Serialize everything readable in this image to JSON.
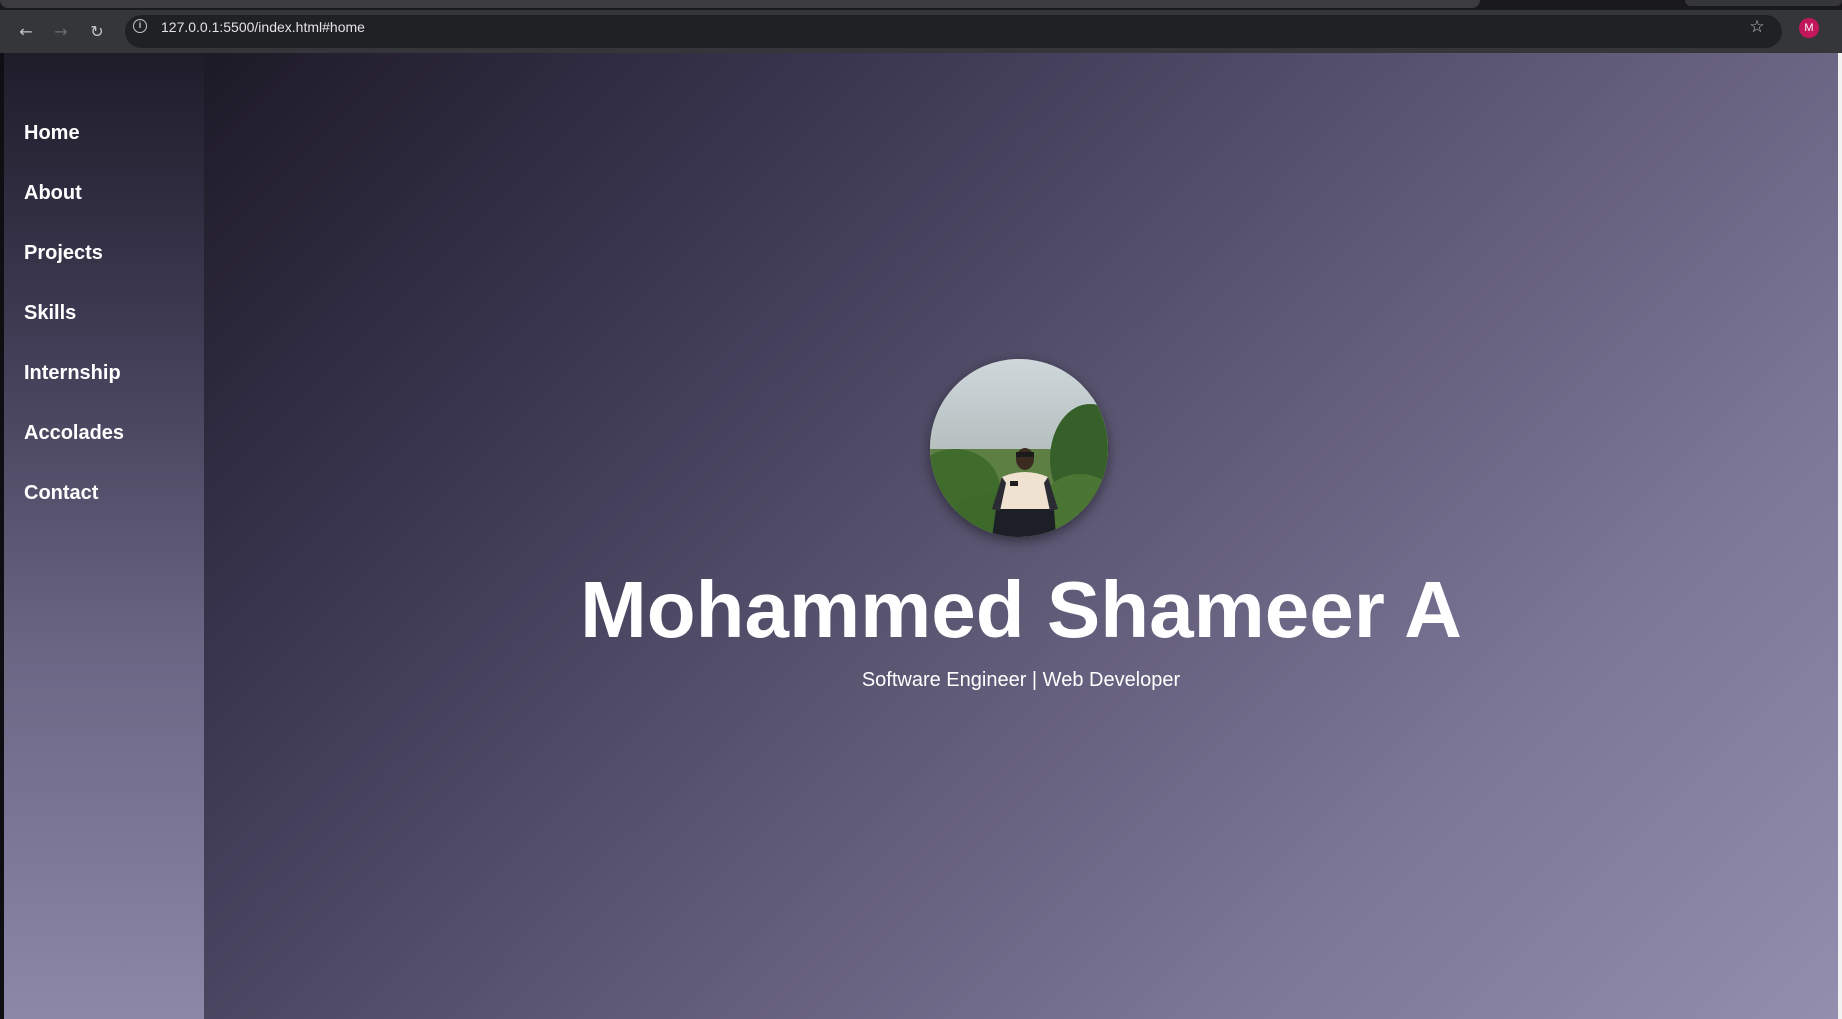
{
  "browser": {
    "url": "127.0.0.1:5500/index.html#home",
    "back_icon": "arrow-left-icon",
    "forward_icon": "arrow-right-icon",
    "reload_icon": "reload-icon",
    "profile_initial": "M",
    "profile_color": "#c2185b"
  },
  "sidebar": {
    "items": [
      {
        "label": "Home"
      },
      {
        "label": "About"
      },
      {
        "label": "Projects"
      },
      {
        "label": "Skills"
      },
      {
        "label": "Internship"
      },
      {
        "label": "Accolades"
      },
      {
        "label": "Contact"
      }
    ]
  },
  "hero": {
    "name": "Mohammed Shameer A",
    "subtitle": "Software Engineer | Web Developer"
  },
  "colors": {
    "gradient_dark": "#1d1a27",
    "gradient_light": "#938ead",
    "text": "#ffffff"
  }
}
